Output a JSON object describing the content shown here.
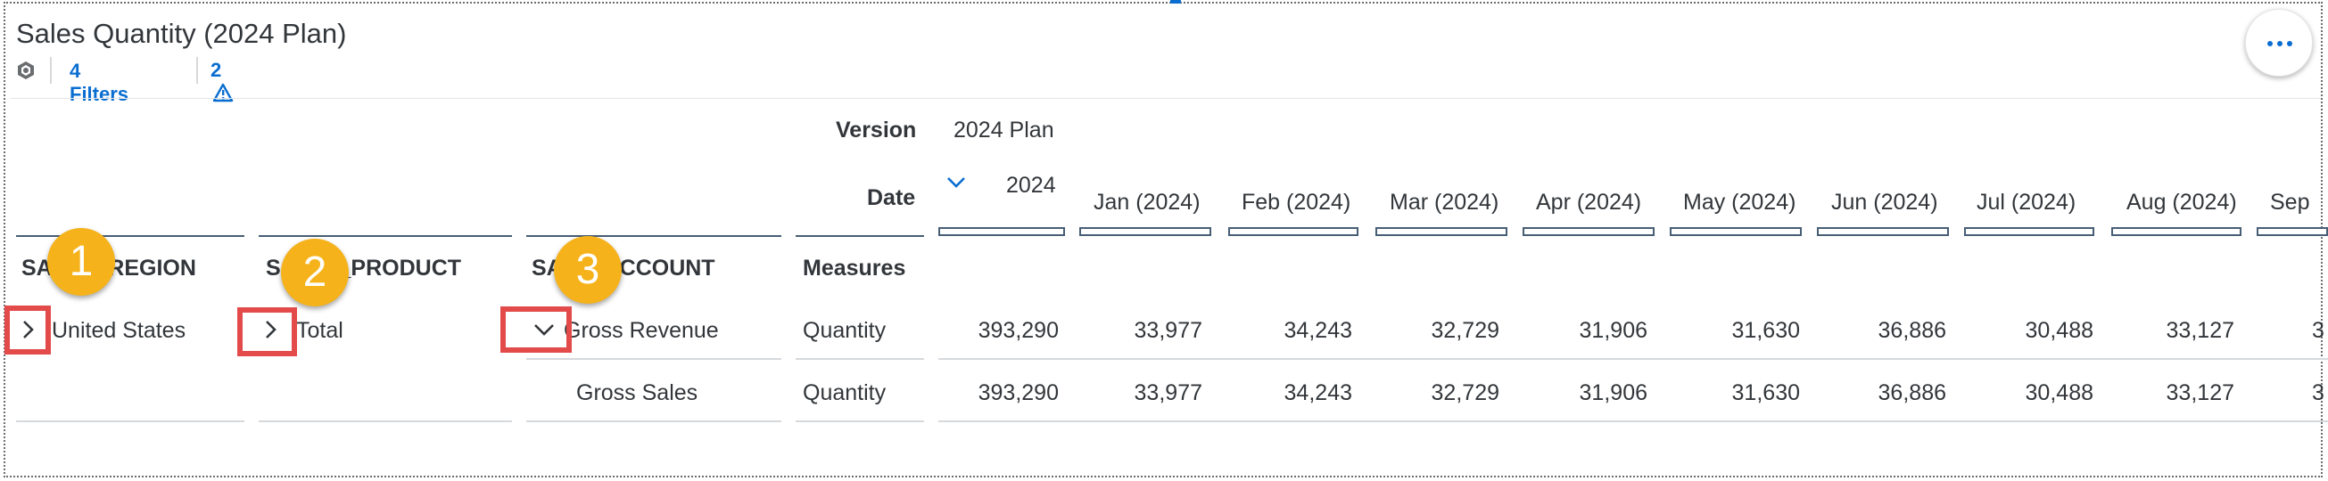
{
  "title": "Sales Quantity (2024 Plan)",
  "toolbar": {
    "filters_label": "4 Filters",
    "warnings_count": "2",
    "more_label": "More actions"
  },
  "headers": {
    "version_label": "Version",
    "version_value": "2024 Plan",
    "date_label": "Date",
    "date_year": "2024",
    "months": [
      "Jan (2024)",
      "Feb (2024)",
      "Mar (2024)",
      "Apr (2024)",
      "May (2024)",
      "Jun (2024)",
      "Jul (2024)",
      "Aug (2024)",
      "Sep"
    ],
    "dim_region": "SAP_B_REGION",
    "dim_product": "SA_PA_PRODUCT",
    "dim_account": "SA_A_ACCOUNT",
    "measures": "Measures"
  },
  "rows": [
    {
      "region": "United States",
      "product": "Total",
      "account": "Gross Revenue",
      "measure": "Quantity",
      "total": "393,290",
      "months": [
        "33,977",
        "34,243",
        "32,729",
        "31,906",
        "31,630",
        "36,886",
        "30,488",
        "33,127"
      ]
    },
    {
      "region": "",
      "product": "",
      "account": "Gross Sales",
      "measure": "Quantity",
      "total": "393,290",
      "months": [
        "33,977",
        "34,243",
        "32,729",
        "31,906",
        "31,630",
        "36,886",
        "30,488",
        "33,127"
      ]
    }
  ],
  "callouts": [
    "1",
    "2",
    "3"
  ],
  "colors": {
    "accent": "#0a6ed1",
    "callout": "#f5b21a",
    "highlight": "#e34b4b",
    "text": "#32363a"
  }
}
